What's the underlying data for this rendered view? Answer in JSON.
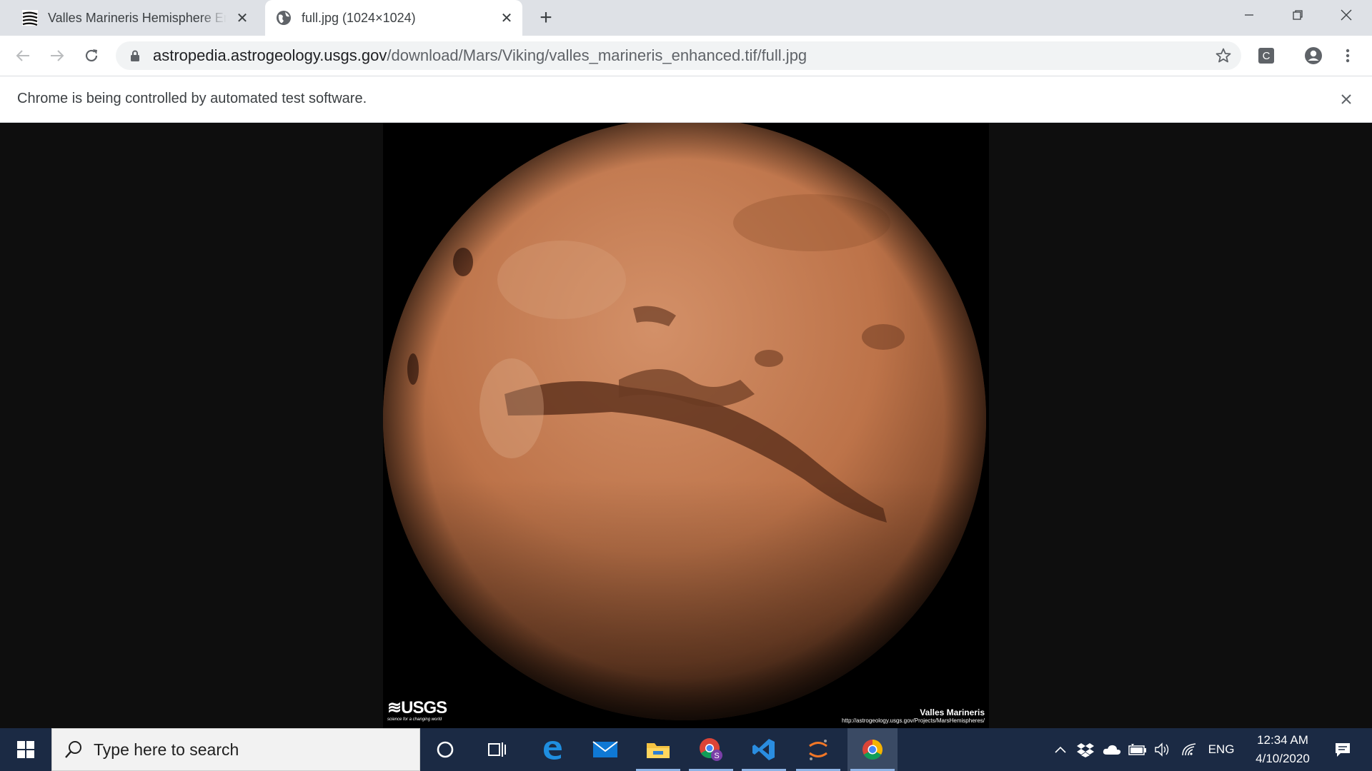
{
  "browser": {
    "tabs": [
      {
        "title": "Valles Marineris Hemisphere Enh",
        "favicon": "usgs-favicon",
        "active": false
      },
      {
        "title": "full.jpg (1024×1024)",
        "favicon": "globe-icon",
        "active": true
      }
    ],
    "address": {
      "host": "astropedia.astrogeology.usgs.gov",
      "path": "/download/Mars/Viking/valles_marineris_enhanced.tif/full.jpg"
    },
    "extension_letter": "C",
    "infobar_text": "Chrome is being controlled by automated test software."
  },
  "image": {
    "logo_text": "≋USGS",
    "logo_tagline": "science for a changing world",
    "caption_title": "Valles Marineris",
    "caption_url": "http://astrogeology.usgs.gov/Projects/MarsHemispheres/"
  },
  "taskbar": {
    "search_placeholder": "Type here to search",
    "language": "ENG",
    "time": "12:34 AM",
    "date": "4/10/2020",
    "pinned": [
      "cortana-icon",
      "task-view-icon",
      "edge-icon",
      "mail-icon",
      "file-explorer-icon",
      "chrome-profile-icon",
      "vscode-icon",
      "jupyter-icon",
      "chrome-icon"
    ]
  },
  "colors": {
    "tabstrip": "#dee1e6",
    "taskbar": "#1b2a44",
    "mars": "#c1764a",
    "page_bg": "#0e0e0e"
  }
}
